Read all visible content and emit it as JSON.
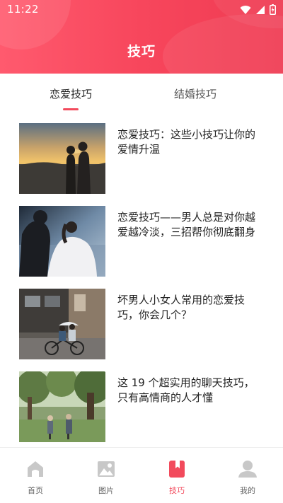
{
  "status_bar": {
    "time": "11:22",
    "icons": [
      "wifi-icon",
      "cellular-signal-icon",
      "battery-charging-icon"
    ]
  },
  "header": {
    "title": "技巧"
  },
  "tabs": [
    {
      "label": "恋爱技巧",
      "selected": true
    },
    {
      "label": "结婚技巧",
      "selected": false
    }
  ],
  "articles": [
    {
      "title": "恋爱技巧：这些小技巧让你的爱情升温",
      "image": "couple-sunset-silhouette"
    },
    {
      "title": "恋爱技巧——男人总是对你越爱越冷淡，三招帮你彻底翻身",
      "image": "couple-embrace-water"
    },
    {
      "title": "坏男人小女人常用的恋爱技巧，你会几个？",
      "image": "couple-bicycle-umbrella"
    },
    {
      "title": "这 19 个超实用的聊天技巧，只有高情商的人才懂",
      "image": "elderly-couple-park"
    }
  ],
  "bottom_nav": [
    {
      "label": "首页",
      "icon": "home-icon",
      "active": false
    },
    {
      "label": "图片",
      "icon": "image-icon",
      "active": false
    },
    {
      "label": "技巧",
      "icon": "bookmark-book-icon",
      "active": true
    },
    {
      "label": "我的",
      "icon": "user-icon",
      "active": false
    }
  ],
  "colors": {
    "accent": "#f24a5c",
    "header_gradient_start": "#ff5a6e",
    "header_gradient_end": "#ef3b52",
    "inactive_icon": "#c8c8c8"
  }
}
